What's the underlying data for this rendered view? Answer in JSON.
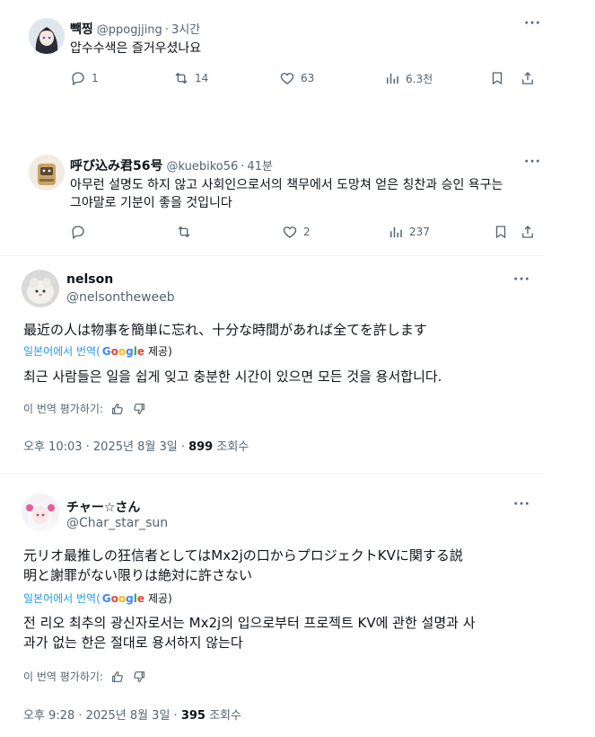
{
  "tweet1": {
    "name": "빽찡",
    "handle": "@ppogjjing",
    "time": "3시간",
    "text": "압수수색은 즐거우셨나요",
    "replies": "1",
    "retweets": "14",
    "likes": "63",
    "views": "6.3천"
  },
  "tweet2": {
    "name": "呼び込み君56号",
    "handle": "@kuebiko56",
    "time": "41분",
    "text_line1": "아무런 설명도 하지 않고 사회인으로서의 책무에서 도망쳐 얻은 칭찬과 승인 욕구는",
    "text_line2": "그야말로 기분이 좋을 것입니다",
    "replies": "",
    "retweets": "",
    "likes": "2",
    "views": "237"
  },
  "post1": {
    "name": "nelson",
    "handle": "@nelsontheweeb",
    "original": "最近の人は物事を簡単に忘れ、十分な時間があれば全てを許します",
    "translated_from": "일본어에서 번역(",
    "google": "Google",
    "provider": "제공)",
    "translation": "최근 사람들은 일을 쉽게 잊고 충분한 시간이 있으면 모든 것을 용서합니다.",
    "rate_label": "이 번역 평가하기:",
    "timestamp": "오후 10:03 · 2025년 8월 3일 · ",
    "views_count": "899",
    "views_label": " 조회수"
  },
  "post2": {
    "name": "チャー☆さん",
    "handle": "@Char_star_sun",
    "original_line1": "元リオ最推しの狂信者としてはMx2jの口からプロジェクトKVに関する説",
    "original_line2": "明と謝罪がない限りは絶対に許さない",
    "translated_from": "일본어에서 번역(",
    "google": "Google",
    "provider": "제공)",
    "translation_line1": "전 리오 최추의 광신자로서는 Mx2j의 입으로부터 프로젝트 KV에 관한 설명과 사",
    "translation_line2": "과가 없는 한은 절대로 용서하지 않는다",
    "rate_label": "이 번역 평가하기:",
    "timestamp": "오후 9:28 · 2025년 8월 3일 · ",
    "views_count": "395",
    "views_label": " 조회수"
  },
  "more_label": "···",
  "colors": {
    "link": "#1d9bf0",
    "muted": "#536471",
    "text": "#0f1419",
    "border": "#eff3f4"
  }
}
